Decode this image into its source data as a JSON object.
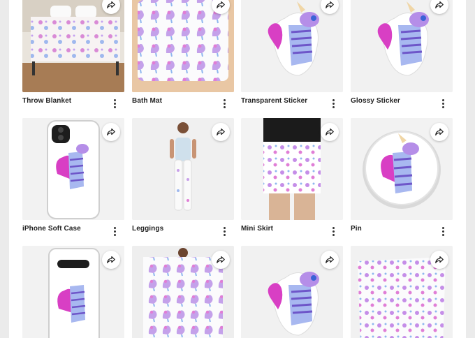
{
  "products": [
    {
      "id": "throw-blanket",
      "label": "Throw Blanket",
      "icon": "throw-blanket-image"
    },
    {
      "id": "bath-mat",
      "label": "Bath Mat",
      "icon": "bath-mat-image"
    },
    {
      "id": "transparent-sticker",
      "label": "Transparent Sticker",
      "icon": "zebra-sticker-image"
    },
    {
      "id": "glossy-sticker",
      "label": "Glossy Sticker",
      "icon": "zebra-sticker-image"
    },
    {
      "id": "iphone-soft-case",
      "label": "iPhone Soft Case",
      "icon": "phone-case-image"
    },
    {
      "id": "leggings",
      "label": "Leggings",
      "icon": "leggings-image"
    },
    {
      "id": "mini-skirt",
      "label": "Mini Skirt",
      "icon": "mini-skirt-image"
    },
    {
      "id": "pin",
      "label": "Pin",
      "icon": "pin-button-image"
    },
    {
      "id": "phone-case-2",
      "label": "",
      "icon": "phone-case-image"
    },
    {
      "id": "scarf",
      "label": "",
      "icon": "scarf-image"
    },
    {
      "id": "sticker-3",
      "label": "",
      "icon": "zebra-sticker-image"
    },
    {
      "id": "tapestry",
      "label": "",
      "icon": "tapestry-image"
    }
  ],
  "colors": {
    "accent_pink": "#e04fc0",
    "accent_purple": "#8f6ee0",
    "accent_blue": "#6aa8f0",
    "background": "#ebebeb"
  }
}
